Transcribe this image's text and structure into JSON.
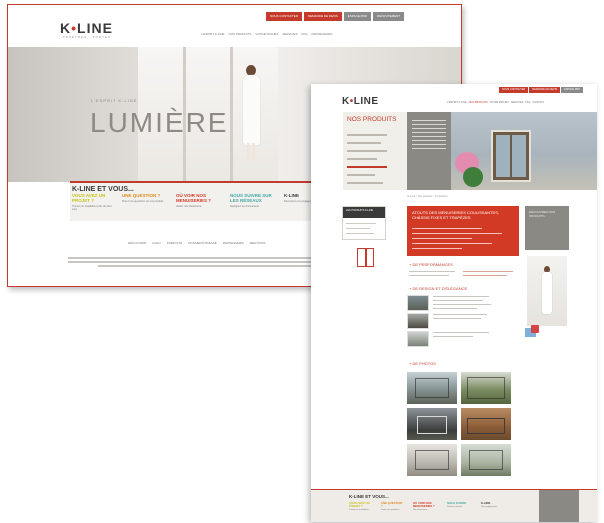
{
  "colors": {
    "brand_red": "#c43b2c",
    "brand_grey": "#8a8984",
    "yellow_green": "#c5c21b",
    "orange": "#e08a1b",
    "red": "#d33a25",
    "teal": "#3fa8a3"
  },
  "back_page": {
    "logo": {
      "text_left": "K",
      "dot": "•",
      "text_right": "LINE",
      "tagline": "FENÊTRES · PORTES"
    },
    "header_buttons": [
      "NOUS CONTACTER",
      "DEMANDE DE DEVIS",
      "ESPACE PRO",
      "RECRUTEMENT"
    ],
    "nav": [
      "L'ESPRIT K-LINE",
      "NOS PRODUITS",
      "VOTRE PROJET",
      "SERVICES",
      "FAQ",
      "PARTENAIRES"
    ],
    "hero": {
      "kicker": "L'ESPRIT K-LINE",
      "title": "LUMIÈRE"
    },
    "section": {
      "title": "K-LINE ET VOUS...",
      "columns": [
        {
          "title": "VOUS AVEZ UN PROJET ?",
          "desc": "Trouver un installateur près de chez vous",
          "color": "#c5c21b"
        },
        {
          "title": "UNE QUESTION ?",
          "desc": "Posez vos questions sur nos produits",
          "color": "#e08a1b"
        },
        {
          "title": "OÙ VOIR NOS MENUISERIES ?",
          "desc": "Visitez nos showrooms",
          "color": "#d33a25"
        },
        {
          "title": "NOUS SUIVRE SUR LES RÉSEAUX",
          "desc": "Rejoignez la communauté",
          "color": "#3fa8a3"
        },
        {
          "title": "K-LINE",
          "desc": "Découvrez nos engagements",
          "color": "#3a3a3a"
        }
      ]
    },
    "links": [
      "DÉCOUVRIR",
      "LOGO",
      "PUBLICITÉ",
      "DOSSIERS PRESSE",
      "PARTENAIRES",
      "MENTIONS"
    ]
  },
  "front_page": {
    "logo": {
      "text_left": "K",
      "dot": "•",
      "text_right": "LINE"
    },
    "header_buttons": [
      "NOUS CONTACTER",
      "DEMANDE DE DEVIS",
      "ESPACE PRO"
    ],
    "nav": [
      "L'ESPRIT K-LINE",
      "NOS PRODUITS",
      "VOTRE PROJET",
      "SERVICES",
      "FAQ",
      "CONTACT"
    ],
    "products_title": "NOS PRODUITS",
    "breadcrumb": "Accueil > Nos produits > Coulissants",
    "left_card_title": "LES PRODUITS K-LINE",
    "red_box_title": "ATOUTS DES MENUISERIES COULISSANTES, CHÂSSIS FIXES ET TRAPÈZES",
    "right_panel_text": "DÉCOUVREZ NOS PRODUITS",
    "sections": [
      "+ DE PERFORMANCES",
      "+ DE DESIGN ET D'ÉLÉGANCE",
      "+ DE PHOTOS"
    ],
    "footer": {
      "title": "K-LINE ET VOUS...",
      "columns": [
        {
          "title": "VOUS AVEZ UN PROJET ?",
          "desc": "Trouver un installateur",
          "color": "#c5c21b"
        },
        {
          "title": "UNE QUESTION ?",
          "desc": "Posez vos questions",
          "color": "#e08a1b"
        },
        {
          "title": "OÙ VOIR NOS MENUISERIES ?",
          "desc": "Nos showrooms",
          "color": "#d33a25"
        },
        {
          "title": "NOUS SUIVRE",
          "desc": "Réseaux sociaux",
          "color": "#3fa8a3"
        },
        {
          "title": "K-LINE",
          "desc": "Nos engagements",
          "color": "#3a3a3a"
        }
      ]
    }
  }
}
